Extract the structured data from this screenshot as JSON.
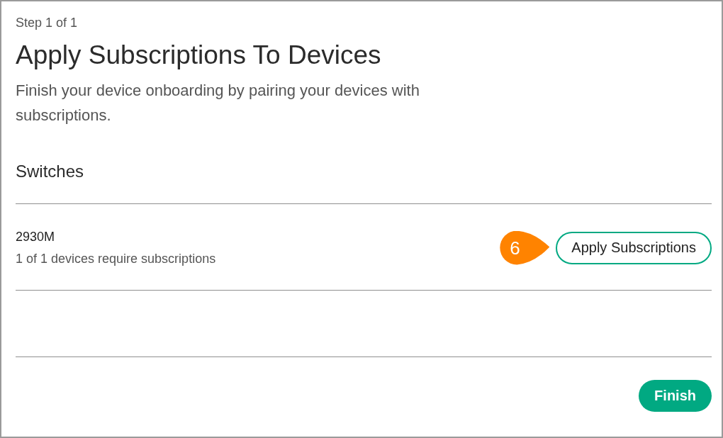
{
  "step_label": "Step 1 of 1",
  "title": "Apply Subscriptions To Devices",
  "description": "Finish your device onboarding by pairing your devices with subscriptions.",
  "section": {
    "title": "Switches",
    "devices": [
      {
        "model": "2930M",
        "status": "1 of 1 devices require subscriptions",
        "action": "Apply Subscriptions",
        "callout": "6"
      }
    ]
  },
  "finish_button": "Finish"
}
